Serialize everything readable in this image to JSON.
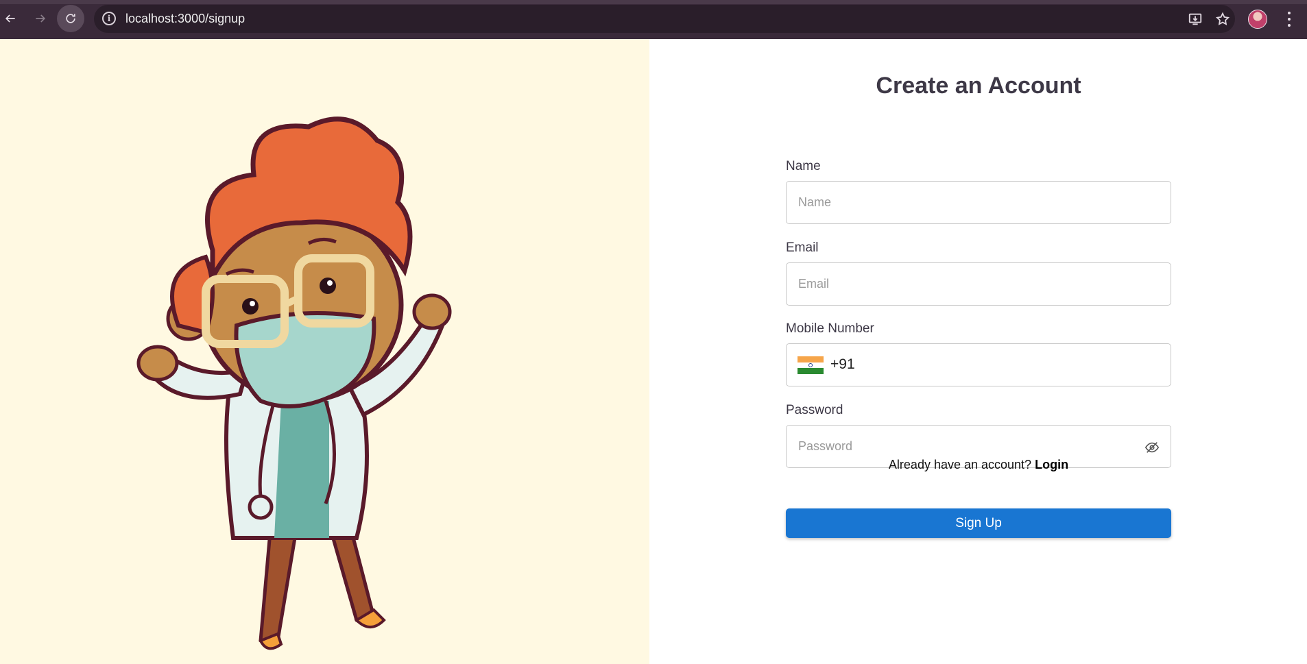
{
  "browser": {
    "url": "localhost:3000/signup",
    "icons": [
      "back-arrow-icon",
      "forward-arrow-icon",
      "reload-icon",
      "site-info-icon",
      "install-app-icon",
      "bookmark-star-icon",
      "profile-avatar",
      "menu-kebab-icon"
    ]
  },
  "form": {
    "title": "Create an Account",
    "name": {
      "label": "Name",
      "placeholder": "Name",
      "value": ""
    },
    "email": {
      "label": "Email",
      "placeholder": "Email",
      "value": ""
    },
    "mobile": {
      "label": "Mobile Number",
      "country_flag": "india-flag-icon",
      "dial_code": "+91",
      "value": ""
    },
    "password": {
      "label": "Password",
      "placeholder": "Password",
      "value": "",
      "toggle_icon": "eye-off-icon"
    },
    "login_prompt": "Already have an account?",
    "login_link": "Login",
    "submit_label": "Sign Up"
  },
  "colors": {
    "left_pane_bg": "#fff9e2",
    "primary_button": "#1976d2",
    "browser_chrome": "#3a2a3a",
    "title_text": "#3d3846"
  }
}
